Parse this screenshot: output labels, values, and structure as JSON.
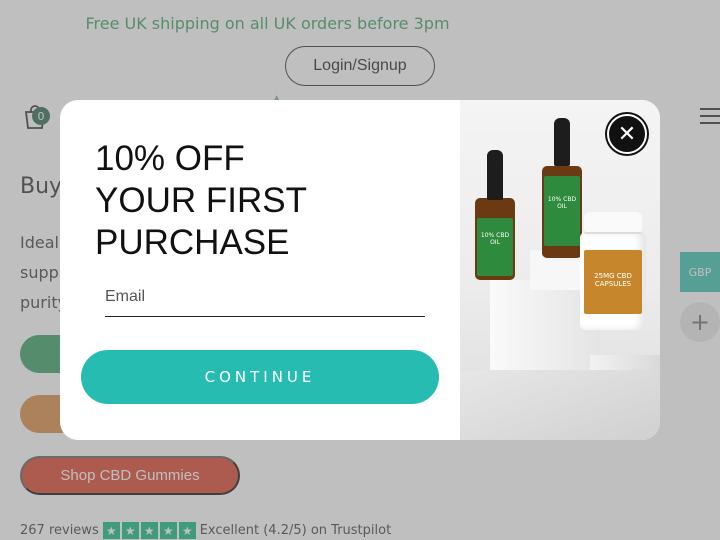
{
  "promo_bar": {
    "text": "Free UK shipping on all UK orders before 3pm"
  },
  "header": {
    "login_label": "Login/Signup",
    "cart_count": "0",
    "menu_icon": "hamburger-menu-icon"
  },
  "page": {
    "heading_partial": "Buy",
    "body_lines": [
      "Ideal",
      "supp",
      "purity"
    ],
    "gummies_button": "Shop CBD Gummies",
    "reviews": {
      "count_label": "267 reviews",
      "rating_label": "Excellent (4.2/5) on Trustpilot",
      "stars": 5
    }
  },
  "side_widgets": {
    "currency": "GBP",
    "expand_symbol": "+"
  },
  "modal": {
    "title_lines": [
      "10% OFF",
      "YOUR FIRST",
      "PURCHASE"
    ],
    "email_placeholder": "Email",
    "continue_label": "CONTINUE",
    "close_symbol": "✕",
    "product_labels": {
      "left_bottle": "10% CBD OIL",
      "right_bottle": "10% CBD OIL",
      "jar": "25MG CBD CAPSULES"
    }
  },
  "colors": {
    "accent_teal": "#27bcb1",
    "promo_green": "#2e9a57",
    "gummies_red": "#d8361c",
    "trustpilot_green": "#00b67a"
  }
}
